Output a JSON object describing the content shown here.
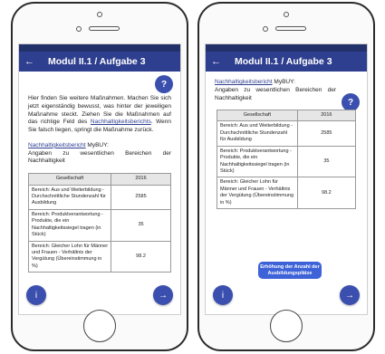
{
  "app": {
    "title": "Modul II.1 / Aufgabe 3",
    "intro": "Hier finden Sie weitere Maßnahmen. Machen Sie sich jetzt eigenständig bewusst, was hinter der jeweiligen Maßnahme steckt. Ziehen Sie die Maßnahmen auf das richtige Feld des",
    "intro_link": "Nachhaltigkeitsberichts",
    "intro_end": ". Wenn Sie falsch liegen, springt die Maßnahme zurück.",
    "report_link": "Nachhaltigkeitsbericht",
    "report_company": " MyBUY:",
    "report_desc": "Angaben zu wesentlichen Bereichen der Nachhaltigkeit",
    "help_label": "?",
    "info_label": "i",
    "next_label": "→",
    "back_label": "←",
    "action_button": "Erhöhung der Anzahl der Ausbildungsplätze"
  },
  "table": {
    "headers": [
      "Gesellschaft",
      "2016"
    ],
    "rows": [
      {
        "label": "Bereich: Aus und Weiterbildung - Durchschnittliche Stundenzahl für Ausbildung",
        "value": "2585"
      },
      {
        "label": "Bereich: Produktverantwortung - Produkte, die ein Nachhaltigkeitssiegel tragen (in Stück)",
        "value": "35"
      },
      {
        "label": "Bereich: Gleicher Lohn für Männer und Frauen - Verhältnis der Vergütung (Überein­stimmung in %)",
        "value": "98.2"
      }
    ]
  },
  "colors": {
    "appbar": "#2f3f8f",
    "statusbar": "#23316b",
    "fab": "#3b4fae",
    "action": "#3e62d8"
  },
  "icons": {
    "back": "arrow-left-icon",
    "help": "question-icon",
    "info": "info-icon",
    "next": "arrow-right-icon"
  }
}
